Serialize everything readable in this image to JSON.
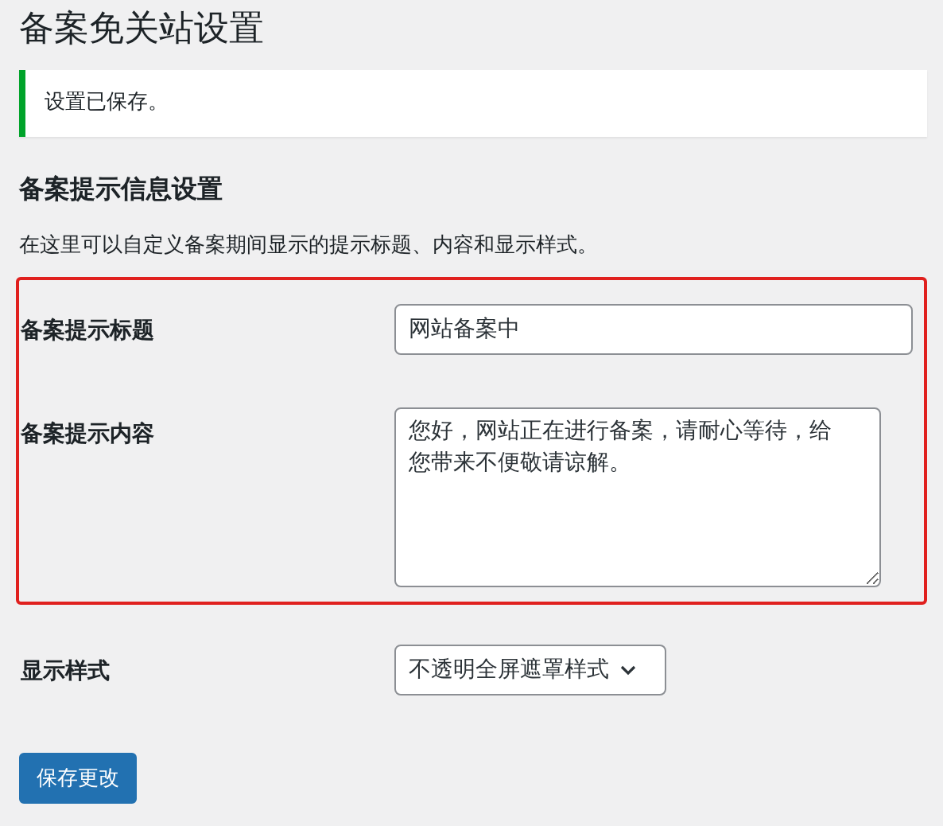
{
  "page": {
    "title": "备案免关站设置"
  },
  "notice": {
    "text": "设置已保存。"
  },
  "section": {
    "heading": "备案提示信息设置",
    "description": "在这里可以自定义备案期间显示的提示标题、内容和显示样式。"
  },
  "fields": [
    {
      "kind": "text",
      "label": "备案提示标题",
      "value": "网站备案中",
      "highlighted": true
    },
    {
      "kind": "textarea",
      "label": "备案提示内容",
      "value": "您好，网站正在进行备案，请耐心等待，给您带来不便敬请谅解。",
      "highlighted": true
    },
    {
      "kind": "select",
      "label": "显示样式",
      "value": "不透明全屏遮罩样式",
      "highlighted": false
    }
  ],
  "submit": {
    "label": "保存更改"
  }
}
